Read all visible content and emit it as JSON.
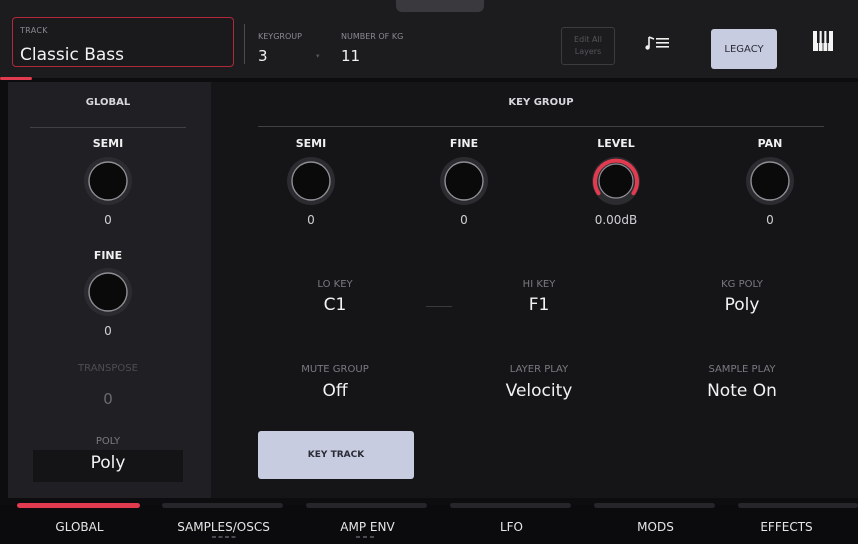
{
  "top_bar": {
    "track_caption": "TRACK",
    "track_name": "Classic Bass",
    "keygroup_caption": "KEYGROUP",
    "keygroup_value": "3",
    "number_kg_caption": "NUMBER OF KG",
    "number_kg_value": "11",
    "edit_all_layers_label": "Edit All Layers",
    "legacy_label": "LEGACY",
    "note_list_icon": "note-list-icon",
    "piano_icon": "piano-keys-icon"
  },
  "global": {
    "title": "GLOBAL",
    "semi_label": "SEMI",
    "semi_value": "0",
    "fine_label": "FINE",
    "fine_value": "0",
    "transpose_label": "TRANSPOSE",
    "transpose_value": "0",
    "poly_label": "POLY",
    "poly_value": "Poly"
  },
  "key_group": {
    "title": "KEY GROUP",
    "knobs": [
      {
        "label": "SEMI",
        "value": "0"
      },
      {
        "label": "FINE",
        "value": "0"
      },
      {
        "label": "LEVEL",
        "value": "0.00dB"
      },
      {
        "label": "PAN",
        "value": "0"
      }
    ],
    "lo_key_label": "LO KEY",
    "lo_key_value": "C1",
    "hi_key_label": "HI KEY",
    "hi_key_value": "F1",
    "kg_poly_label": "KG POLY",
    "kg_poly_value": "Poly",
    "mute_group_label": "MUTE GROUP",
    "mute_group_value": "Off",
    "layer_play_label": "LAYER PLAY",
    "layer_play_value": "Velocity",
    "sample_play_label": "SAMPLE PLAY",
    "sample_play_value": "Note On",
    "key_track_label": "KEY TRACK"
  },
  "tabs": [
    "GLOBAL",
    "SAMPLES/OSCS",
    "AMP ENV",
    "LFO",
    "MODS",
    "EFFECTS"
  ],
  "active_tab": "GLOBAL",
  "colors": {
    "accent": "#e23a4f",
    "button_bg": "#c7cce0",
    "panel": "#202024",
    "background": "#151518"
  }
}
